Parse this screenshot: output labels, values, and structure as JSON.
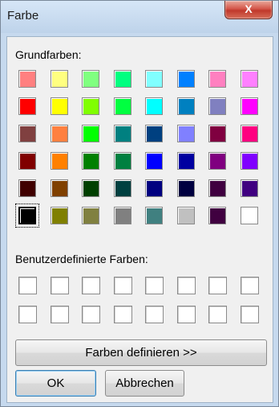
{
  "window": {
    "title": "Farbe",
    "close_glyph": "X"
  },
  "basic_colors": {
    "label": "Grundfarben:",
    "rows": [
      [
        "#ff8080",
        "#ffff80",
        "#80ff80",
        "#00ff80",
        "#80ffff",
        "#0080ff",
        "#ff80c0",
        "#ff80ff"
      ],
      [
        "#ff0000",
        "#ffff00",
        "#80ff00",
        "#00ff40",
        "#00ffff",
        "#0080c0",
        "#8080c0",
        "#ff00ff"
      ],
      [
        "#804040",
        "#ff8040",
        "#00ff00",
        "#008080",
        "#004080",
        "#8080ff",
        "#800040",
        "#ff0080"
      ],
      [
        "#800000",
        "#ff8000",
        "#008000",
        "#008040",
        "#0000ff",
        "#0000a0",
        "#800080",
        "#8000ff"
      ],
      [
        "#400000",
        "#804000",
        "#004000",
        "#004040",
        "#000080",
        "#000040",
        "#400040",
        "#400080"
      ],
      [
        "#000000",
        "#808000",
        "#808040",
        "#808080",
        "#408080",
        "#c0c0c0",
        "#400040",
        "#ffffff"
      ]
    ],
    "selected": "#000000"
  },
  "custom_colors": {
    "label": "Benutzerdefinierte Farben:",
    "rows": [
      [
        "#ffffff",
        "#ffffff",
        "#ffffff",
        "#ffffff",
        "#ffffff",
        "#ffffff",
        "#ffffff",
        "#ffffff"
      ],
      [
        "#ffffff",
        "#ffffff",
        "#ffffff",
        "#ffffff",
        "#ffffff",
        "#ffffff",
        "#ffffff",
        "#ffffff"
      ]
    ]
  },
  "buttons": {
    "define_colors": "Farben definieren >>",
    "ok": "OK",
    "cancel": "Abbrechen"
  }
}
